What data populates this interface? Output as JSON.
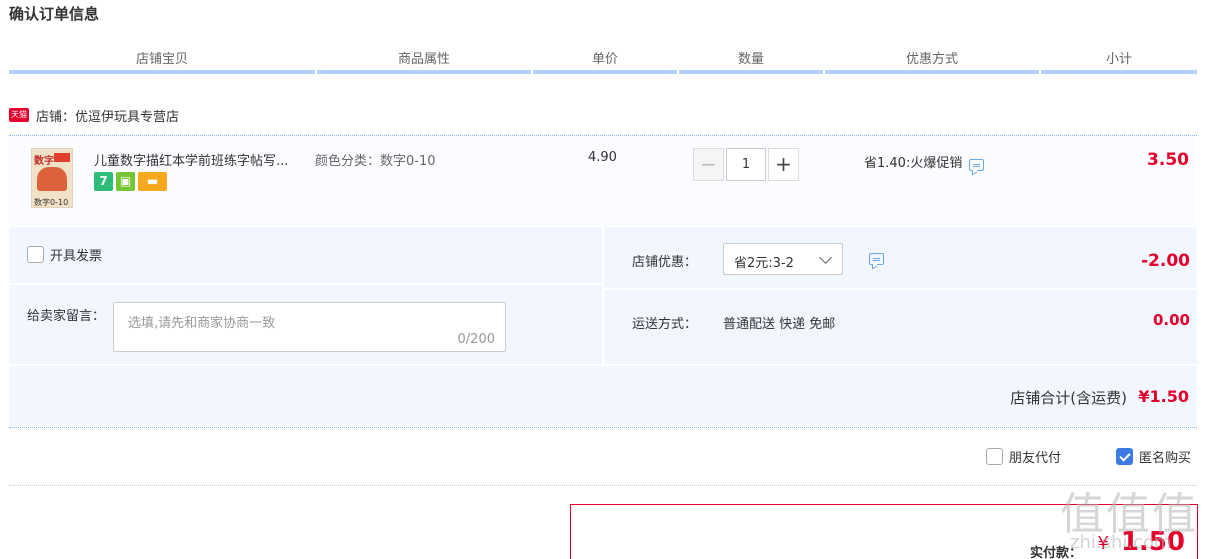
{
  "page": {
    "title": "确认订单信息"
  },
  "table_header": {
    "columns": [
      "店铺宝贝",
      "商品属性",
      "单价",
      "数量",
      "优惠方式",
      "小计"
    ]
  },
  "shop": {
    "badge": "天猫",
    "label": "店铺：优逗伊玩具专营店"
  },
  "item": {
    "thumb_text": "数字",
    "thumb_caption": "数字0-10",
    "title": "儿童数字描红本学前班练字帖写...",
    "badges": [
      "7",
      "",
      ""
    ],
    "attribute": "颜色分类：数字0-10",
    "unit_price": "4.90",
    "quantity": "1",
    "promo": "省1.40:火爆促销",
    "subtotal": "3.50"
  },
  "options": {
    "invoice_label": "开具发票",
    "message_label": "给卖家留言：",
    "message_placeholder": "选填,请先和商家协商一致",
    "message_count": "0/200",
    "shop_discount_label": "店铺优惠：",
    "shop_discount_selected": "省2元:3-2",
    "shop_discount_value": "-2.00",
    "shipping_label": "运送方式：",
    "shipping_value": "普通配送 快递 免邮",
    "shipping_cost": "0.00"
  },
  "shop_total": {
    "label": "店铺合计(含运费)",
    "value": "¥1.50"
  },
  "footer": {
    "friend_pay_label": "朋友代付",
    "anonymous_label": "匿名购买",
    "anonymous_checked": true,
    "pay_label": "实付款：",
    "currency": "¥",
    "pay_amount": "1.50"
  },
  "watermark": {
    "main": "值值值",
    "sub": "zhi.shi.com"
  },
  "colors": {
    "accent": "#e4002b",
    "header_bar": "#b2d1ff",
    "panel_bg": "#f2f7ff",
    "checkbox_checked": "#3d7be3"
  }
}
